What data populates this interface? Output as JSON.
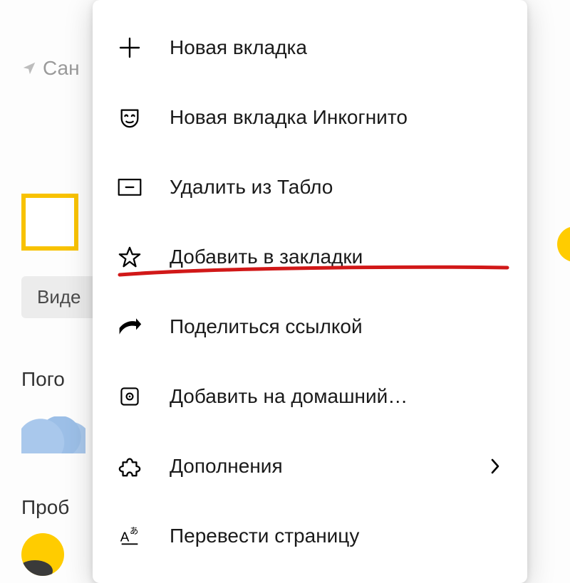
{
  "background": {
    "location_prefix": "Сан",
    "tab": "Виде",
    "card_weather": "Пого",
    "card_traffic": "Проб"
  },
  "menu": {
    "items": [
      {
        "icon": "plus-icon",
        "label": "Новая вкладка",
        "name": "new-tab",
        "chevron": false
      },
      {
        "icon": "mask-icon",
        "label": "Новая вкладка Инкогнито",
        "name": "new-incognito-tab",
        "chevron": false
      },
      {
        "icon": "remove-tile-icon",
        "label": "Удалить из Табло",
        "name": "remove-from-tablo",
        "chevron": false
      },
      {
        "icon": "star-icon",
        "label": "Добавить в закладки",
        "name": "add-to-bookmarks",
        "chevron": false
      },
      {
        "icon": "share-icon",
        "label": "Поделиться ссылкой",
        "name": "share-link",
        "chevron": false
      },
      {
        "icon": "homescreen-icon",
        "label": "Добавить на домашний…",
        "name": "add-to-homescreen",
        "chevron": false
      },
      {
        "icon": "puzzle-icon",
        "label": "Дополнения",
        "name": "extensions",
        "chevron": true
      },
      {
        "icon": "translate-icon",
        "label": "Перевести страницу",
        "name": "translate-page",
        "chevron": false
      }
    ]
  }
}
